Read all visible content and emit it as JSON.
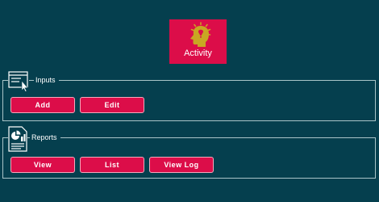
{
  "colors": {
    "background": "#053f4e",
    "accent": "#dc0d49",
    "border": "#a9c4c8",
    "icon_gold": "#c9a623"
  },
  "tile": {
    "label": "Activity",
    "icon": "idea-head-icon"
  },
  "inputs_group": {
    "legend": "Inputs",
    "icon": "form-cursor-icon",
    "buttons": {
      "add": "Add",
      "edit": "Edit"
    }
  },
  "reports_group": {
    "legend": "Reports",
    "icon": "report-document-icon",
    "buttons": {
      "view": "View",
      "list": "List",
      "view_log": "View Log"
    }
  }
}
